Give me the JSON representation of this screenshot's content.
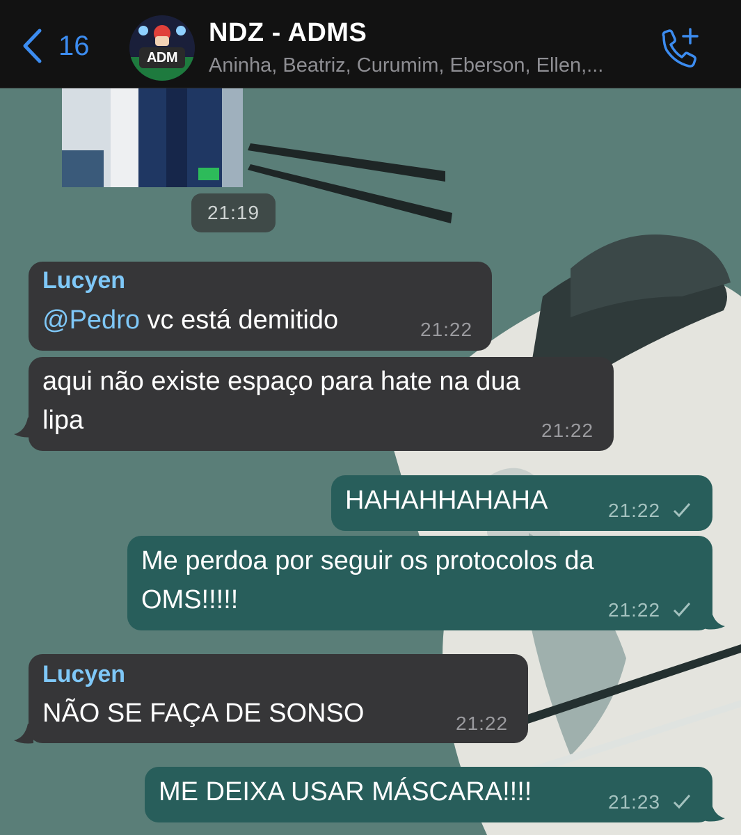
{
  "header": {
    "back_count": "16",
    "group_name": "NDZ - ADMS",
    "avatar_label": "ADM",
    "members": "Aninha, Beatriz, Curumim, Eberson, Ellen,..."
  },
  "icons": {
    "back": "chevron-left-icon",
    "call": "add-call-icon",
    "read": "checkmark-icon"
  },
  "colors": {
    "accent": "#3c8cf0",
    "incoming_bubble": "#363638",
    "outgoing_bubble": "#285e5b",
    "sender_name": "#7fc8f8"
  },
  "photo_time": "21:19",
  "messages": [
    {
      "sender": "Lucyen",
      "mention": "@Pedro",
      "text": " vc está demitido",
      "time": "21:22"
    },
    {
      "text_line1": "aqui não existe espaço para hate na dua",
      "text_line2": "lipa",
      "time": "21:22"
    },
    {
      "text": "HAHAHHAHAHA",
      "time": "21:22"
    },
    {
      "text_line1": "Me perdoa por seguir os protocolos da",
      "text_line2": "OMS!!!!!",
      "time": "21:22"
    },
    {
      "sender": "Lucyen",
      "text": "NÃO SE FAÇA DE SONSO",
      "time": "21:22"
    },
    {
      "text": "ME DEIXA USAR MÁSCARA!!!!",
      "time": "21:23"
    }
  ]
}
